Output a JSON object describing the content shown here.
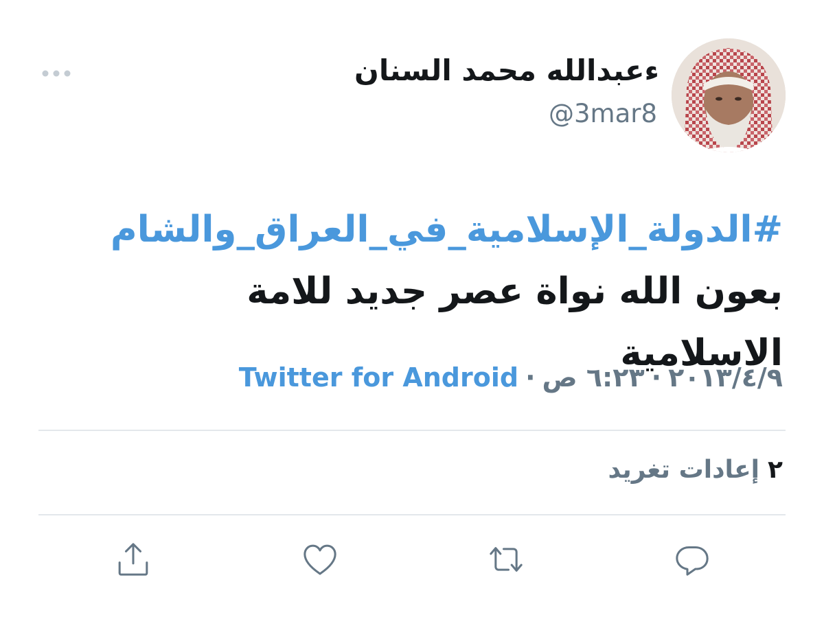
{
  "author": {
    "display_name": "ءعبدالله محمد السنان",
    "handle": "@3mar8"
  },
  "tweet": {
    "hashtag": "#الدولة_الإسلامية_في_العراق_والشام",
    "text": "بعون الله نواة عصر جديد للامة الاسلامية"
  },
  "meta": {
    "date": "٢٠١٣/٤/٩",
    "time": "٦:٢٣ ص",
    "separator": "·",
    "source": "Twitter for Android"
  },
  "stats": {
    "retweets_count": "٢",
    "retweets_label": "إعادات تغريد"
  },
  "icons": {
    "more": "more-dots-icon",
    "reply": "reply-icon",
    "retweet": "retweet-icon",
    "like": "heart-icon",
    "share": "share-icon"
  },
  "colors": {
    "link": "#4a98dc",
    "secondary_text": "#657786",
    "primary_text": "#14171a",
    "divider": "#e3e7eb"
  }
}
